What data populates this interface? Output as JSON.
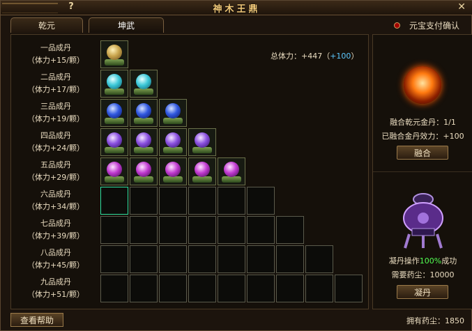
{
  "window": {
    "title": "神木王鼎",
    "help_glyph": "?",
    "close_glyph": "✕"
  },
  "tabs": [
    {
      "label": "乾元"
    },
    {
      "label": "坤武"
    }
  ],
  "confirm": {
    "label": "元宝支付确认"
  },
  "total": {
    "label": "总体力：+447（",
    "plus": "+100",
    "close": "）"
  },
  "rows": [
    {
      "name": "一品成丹",
      "bonus": "（体力+15/颗）",
      "slots": 1,
      "filled": 1,
      "orb": "y"
    },
    {
      "name": "二品成丹",
      "bonus": "（体力+17/颗）",
      "slots": 2,
      "filled": 2,
      "orb": "c"
    },
    {
      "name": "三品成丹",
      "bonus": "（体力+19/颗）",
      "slots": 3,
      "filled": 3,
      "orb": "b"
    },
    {
      "name": "四品成丹",
      "bonus": "（体力+24/颗）",
      "slots": 4,
      "filled": 4,
      "orb": "p"
    },
    {
      "name": "五品成丹",
      "bonus": "（体力+29/颗）",
      "slots": 5,
      "filled": 5,
      "orb": "m"
    },
    {
      "name": "六品成丹",
      "bonus": "（体力+34/颗）",
      "slots": 6,
      "filled": 0,
      "orb": ""
    },
    {
      "name": "七品成丹",
      "bonus": "（体力+39/颗）",
      "slots": 7,
      "filled": 0,
      "orb": ""
    },
    {
      "name": "八品成丹",
      "bonus": "（体力+45/颗）",
      "slots": 8,
      "filled": 0,
      "orb": ""
    },
    {
      "name": "九品成丹",
      "bonus": "（体力+51/颗）",
      "slots": 9,
      "filled": 0,
      "orb": ""
    }
  ],
  "fusion": {
    "line1": "融合乾元金丹：1/1",
    "line2": "已融合金丹效力：+100",
    "button": "融合"
  },
  "refine": {
    "prefix": "凝丹操作",
    "percent": "100%",
    "suffix": "成功",
    "cost": "需要药尘：10000",
    "button": "凝丹"
  },
  "footer": {
    "help": "查看帮助",
    "own": "拥有药尘：1850"
  }
}
